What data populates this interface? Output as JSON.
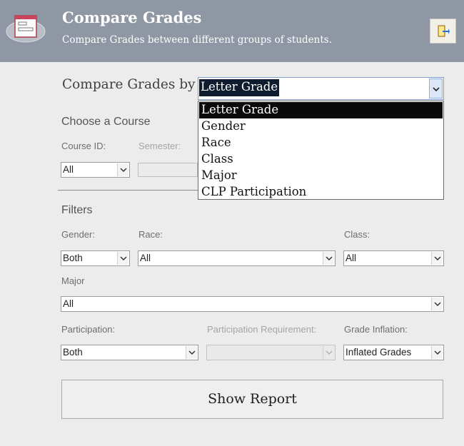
{
  "header": {
    "title": "Compare Grades",
    "subtitle": "Compare Grades between different groups of students."
  },
  "compare": {
    "label": "Compare Grades by",
    "value": "Letter Grade",
    "options": [
      "Letter Grade",
      "Gender",
      "Race",
      "Class",
      "Major",
      "CLP Participation"
    ]
  },
  "course": {
    "heading": "Choose a Course",
    "course_id_label": "Course ID:",
    "course_id_value": "All",
    "semester_label": "Semester:"
  },
  "filters": {
    "heading": "Filters",
    "gender_label": "Gender:",
    "gender_value": "Both",
    "race_label": "Race:",
    "race_value": "All",
    "class_label": "Class:",
    "class_value": "All",
    "major_label": "Major",
    "major_value": "All",
    "participation_label": "Participation:",
    "participation_value": "Both",
    "requirement_label": "Participation Requirement:",
    "requirement_value": "",
    "inflation_label": "Grade Inflation:",
    "inflation_value": "Inflated Grades"
  },
  "show_report_label": "Show Report",
  "colors": {
    "header_bg": "#8e97a3",
    "selection_bg": "#0f1b2e",
    "page_bg": "#ececec"
  }
}
